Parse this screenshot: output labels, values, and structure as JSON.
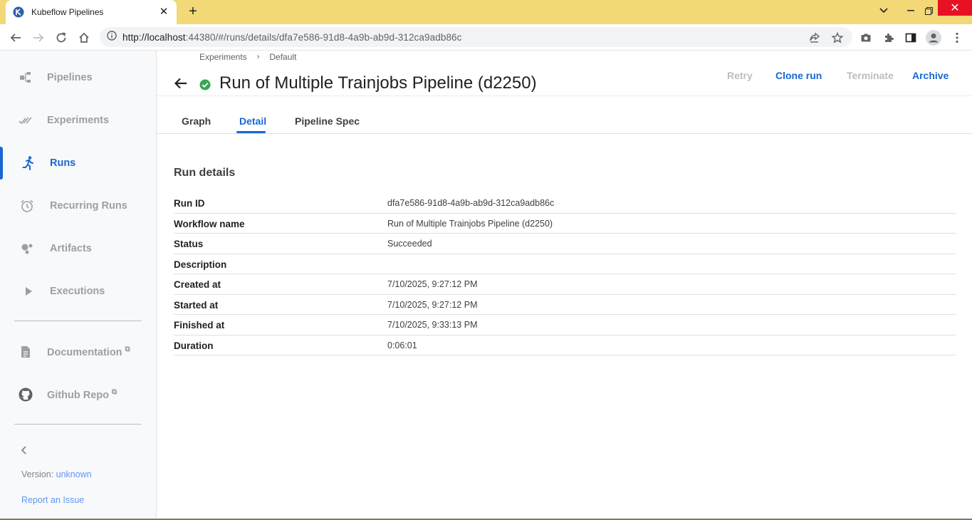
{
  "browser": {
    "tab_title": "Kubeflow Pipelines",
    "url_host": "http://localhost",
    "url_rest": ":44380/#/runs/details/dfa7e586-91d8-4a9b-ab9d-312ca9adb86c"
  },
  "sidebar": {
    "items": [
      {
        "label": "Pipelines",
        "icon": "pipelines-icon"
      },
      {
        "label": "Experiments",
        "icon": "experiments-icon"
      },
      {
        "label": "Runs",
        "icon": "runs-icon"
      },
      {
        "label": "Recurring Runs",
        "icon": "alarm-icon"
      },
      {
        "label": "Artifacts",
        "icon": "artifacts-icon"
      },
      {
        "label": "Executions",
        "icon": "play-icon"
      }
    ],
    "links": [
      {
        "label": "Documentation",
        "icon": "document-icon"
      },
      {
        "label": "Github Repo",
        "icon": "github-icon"
      }
    ],
    "version_label": "Version:",
    "version_value": "unknown",
    "report_issue": "Report an Issue"
  },
  "header": {
    "breadcrumb": [
      "Experiments",
      "Default"
    ],
    "title": "Run of Multiple Trainjobs Pipeline (d2250)",
    "actions": {
      "retry": "Retry",
      "clone": "Clone run",
      "terminate": "Terminate",
      "archive": "Archive"
    }
  },
  "tabs": [
    "Graph",
    "Detail",
    "Pipeline Spec"
  ],
  "active_tab": "Detail",
  "details": {
    "title": "Run details",
    "rows": [
      {
        "key": "Run ID",
        "value": "dfa7e586-91d8-4a9b-ab9d-312ca9adb86c"
      },
      {
        "key": "Workflow name",
        "value": "Run of Multiple Trainjobs Pipeline (d2250)"
      },
      {
        "key": "Status",
        "value": "Succeeded"
      },
      {
        "key": "Description",
        "value": ""
      },
      {
        "key": "Created at",
        "value": "7/10/2025, 9:27:12 PM"
      },
      {
        "key": "Started at",
        "value": "7/10/2025, 9:27:12 PM"
      },
      {
        "key": "Finished at",
        "value": "7/10/2025, 9:33:13 PM"
      },
      {
        "key": "Duration",
        "value": "0:06:01"
      }
    ]
  },
  "colors": {
    "accent": "#1967d2",
    "success": "#34a853",
    "tabbar": "#f2d876"
  }
}
